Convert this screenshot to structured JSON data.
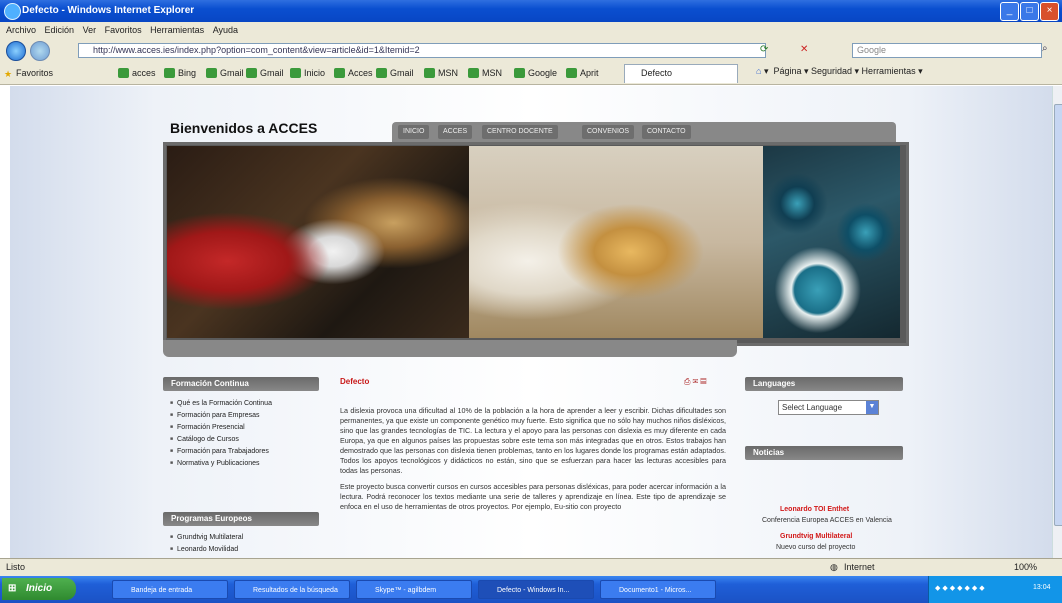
{
  "window": {
    "title": "Defecto - Windows Internet Explorer"
  },
  "menubar": {
    "items": [
      "Archivo",
      "Edición",
      "Ver",
      "Favoritos",
      "Herramientas",
      "Ayuda"
    ]
  },
  "addressbar": {
    "url": "http://www.acces.ies/index.php?option=com_content&view=article&id=1&Itemid=2",
    "search_placeholder": "Google"
  },
  "favorites": {
    "label": "Favoritos",
    "items": [
      "acces",
      "Bing",
      "Gmail",
      "Gmail",
      "Inicio",
      "Acces",
      "Gmail",
      "MSN",
      "MSN",
      "Google",
      "Aprit"
    ],
    "tab_label": "Defecto",
    "commands": "Página ▾  Seguridad ▾  Herramientas ▾"
  },
  "site": {
    "brand": "Bienvenidos a ACCES",
    "nav": [
      "INICIO",
      "ACCES",
      "CENTRO DOCENTE",
      "CONVENIOS",
      "CONTACTO"
    ],
    "sidebar_left": {
      "formacion_title": "Formación Continua",
      "formacion_items": [
        "Qué es la Formación Continua",
        "Formación para Empresas",
        "Formación Presencial",
        "Catálogo de Cursos",
        "Formación para Trabajadores",
        "Normativa y Publicaciones"
      ],
      "programas_title": "Programas Europeos",
      "programas_items": [
        "Grundtvig Multilateral",
        "Leonardo Movilidad"
      ]
    },
    "main": {
      "title": "Defecto",
      "icons": "⎙ ✉ ▤",
      "paragraph1": "La dislexia provoca una dificultad al 10% de la población a la hora de aprender a leer y escribir. Dichas dificultades son permanentes, ya que existe un componente genético muy fuerte. Esto significa que no sólo hay muchos niños disléxicos, sino que las grandes tecnologías de TIC. La lectura y el apoyo para las personas con dislexia es muy diferente en cada Europa, ya que en algunos países las propuestas sobre este tema son más integradas que en otros. Estos trabajos han demostrado que las personas con dislexia tienen problemas, tanto en los lugares donde los programas están adaptados. Todos los apoyos tecnológicos y didácticos no están, sino que se esfuerzan para hacer las lecturas accesibles para todas las personas.",
      "paragraph2": "Este proyecto busca convertir cursos en cursos accesibles para personas disléxicas, para poder acercar información a la lectura. Podrá reconocer los textos mediante una serie de talleres y aprendizaje en línea. Este tipo de aprendizaje se enfoca en el uso de herramientas de otros proyectos. Por ejemplo, Eu-sitio con proyecto"
    },
    "sidebar_right": {
      "language_title": "Languages",
      "language_select": "Select Language",
      "news_title": "Noticias",
      "news": [
        {
          "headline": "Leonardo TOI Enthet",
          "sub": "Conferencia Europea ACCES en Valencia"
        },
        {
          "headline": "Grundtvig Multilateral",
          "sub": "Nuevo curso del proyecto"
        }
      ]
    }
  },
  "statusbar": {
    "left": "Listo",
    "zone": "Internet",
    "zoom": "100%"
  },
  "taskbar": {
    "start": "Inicio",
    "tasks": [
      "Bandeja de entrada",
      "Resultados de la búsqueda",
      "Skype™ - agilbdem",
      "Defecto - Windows In...",
      "Documento1 - Micros..."
    ],
    "clock": "13:04"
  },
  "colors": {
    "accent_red": "#c81818",
    "nav_gray": "#6e6e6e",
    "xp_blue": "#1f5fd8"
  }
}
